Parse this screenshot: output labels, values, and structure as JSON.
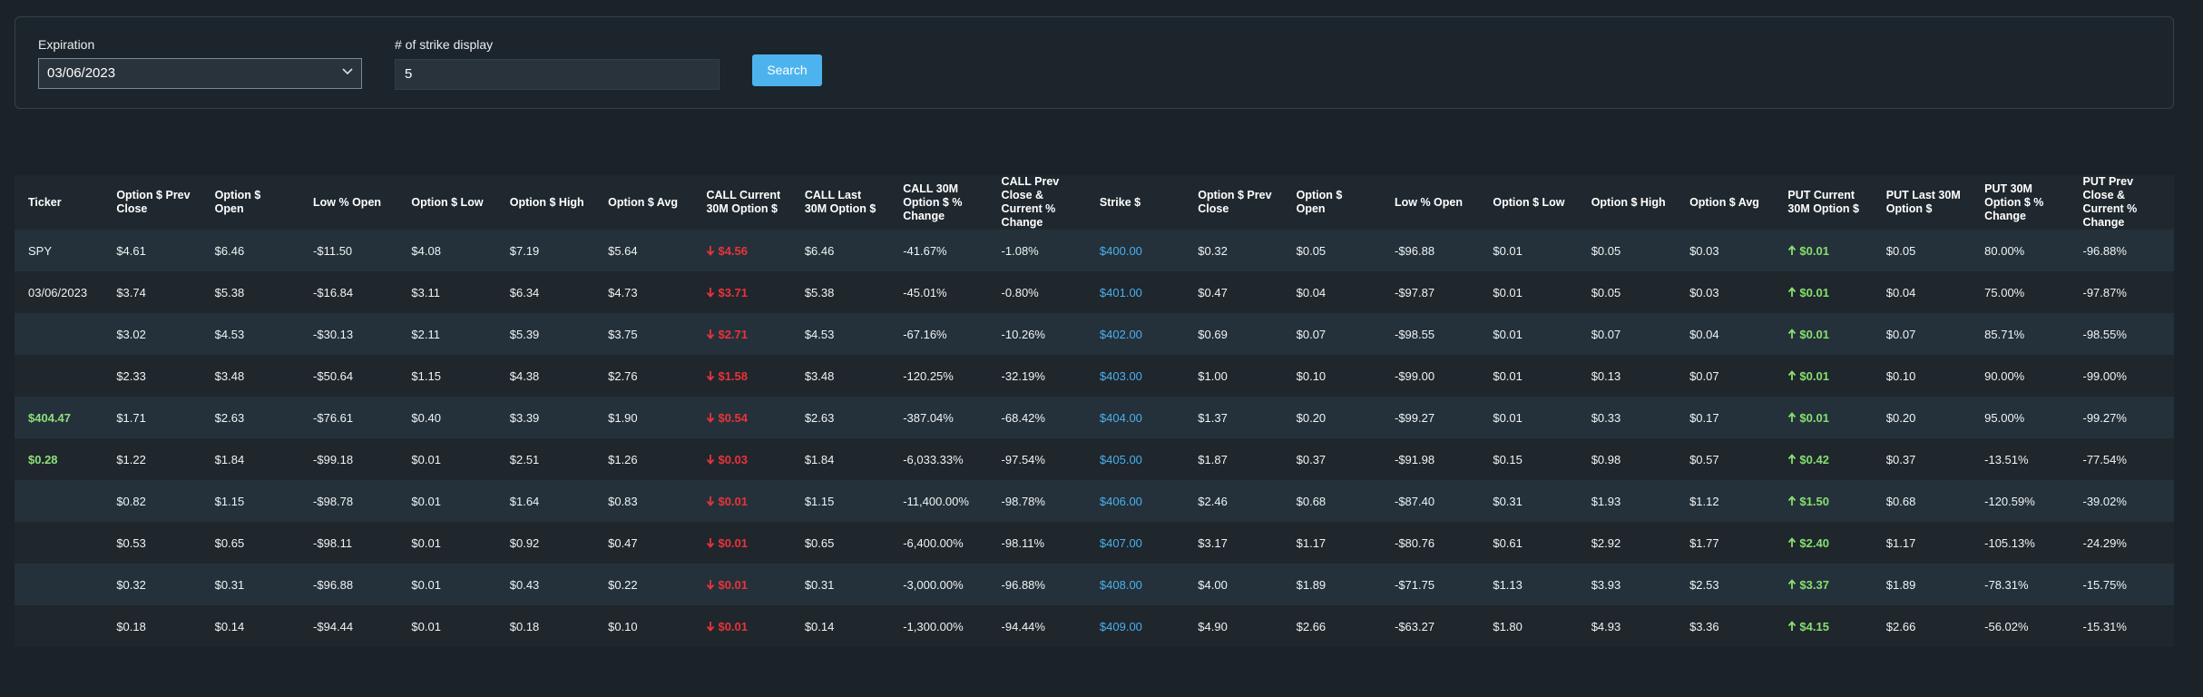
{
  "filters": {
    "expiration_label": "Expiration",
    "expiration_value": "03/06/2023",
    "strike_label": "# of strike display",
    "strike_value": "5",
    "search_label": "Search"
  },
  "table": {
    "headers": [
      "Ticker",
      "Option $ Prev Close",
      "Option $ Open",
      "Low % Open",
      "Option $ Low",
      "Option $ High",
      "Option $ Avg",
      "CALL Current 30M Option $",
      "CALL Last 30M Option $",
      "CALL 30M Option $ % Change",
      "CALL Prev Close & Current % Change",
      "Strike $",
      "Option $ Prev Close",
      "Option $ Open",
      "Low % Open",
      "Option $ Low",
      "Option $ High",
      "Option $ Avg",
      "PUT Current 30M Option $",
      "PUT Last 30M Option $",
      "PUT 30M Option $ % Change",
      "PUT Prev Close & Current % Change"
    ],
    "rows": [
      [
        "SPY",
        "$4.61",
        "$6.46",
        "-$11.50",
        "$4.08",
        "$7.19",
        "$5.64",
        "$4.56",
        "$6.46",
        "-41.67%",
        "-1.08%",
        "$400.00",
        "$0.32",
        "$0.05",
        "-$96.88",
        "$0.01",
        "$0.05",
        "$0.03",
        "$0.01",
        "$0.05",
        "80.00%",
        "-96.88%"
      ],
      [
        "03/06/2023",
        "$3.74",
        "$5.38",
        "-$16.84",
        "$3.11",
        "$6.34",
        "$4.73",
        "$3.71",
        "$5.38",
        "-45.01%",
        "-0.80%",
        "$401.00",
        "$0.47",
        "$0.04",
        "-$97.87",
        "$0.01",
        "$0.05",
        "$0.03",
        "$0.01",
        "$0.04",
        "75.00%",
        "-97.87%"
      ],
      [
        "",
        "$3.02",
        "$4.53",
        "-$30.13",
        "$2.11",
        "$5.39",
        "$3.75",
        "$2.71",
        "$4.53",
        "-67.16%",
        "-10.26%",
        "$402.00",
        "$0.69",
        "$0.07",
        "-$98.55",
        "$0.01",
        "$0.07",
        "$0.04",
        "$0.01",
        "$0.07",
        "85.71%",
        "-98.55%"
      ],
      [
        "",
        "$2.33",
        "$3.48",
        "-$50.64",
        "$1.15",
        "$4.38",
        "$2.76",
        "$1.58",
        "$3.48",
        "-120.25%",
        "-32.19%",
        "$403.00",
        "$1.00",
        "$0.10",
        "-$99.00",
        "$0.01",
        "$0.13",
        "$0.07",
        "$0.01",
        "$0.10",
        "90.00%",
        "-99.00%"
      ],
      [
        "$404.47",
        "$1.71",
        "$2.63",
        "-$76.61",
        "$0.40",
        "$3.39",
        "$1.90",
        "$0.54",
        "$2.63",
        "-387.04%",
        "-68.42%",
        "$404.00",
        "$1.37",
        "$0.20",
        "-$99.27",
        "$0.01",
        "$0.33",
        "$0.17",
        "$0.01",
        "$0.20",
        "95.00%",
        "-99.27%"
      ],
      [
        "$0.28",
        "$1.22",
        "$1.84",
        "-$99.18",
        "$0.01",
        "$2.51",
        "$1.26",
        "$0.03",
        "$1.84",
        "-6,033.33%",
        "-97.54%",
        "$405.00",
        "$1.87",
        "$0.37",
        "-$91.98",
        "$0.15",
        "$0.98",
        "$0.57",
        "$0.42",
        "$0.37",
        "-13.51%",
        "-77.54%"
      ],
      [
        "",
        "$0.82",
        "$1.15",
        "-$98.78",
        "$0.01",
        "$1.64",
        "$0.83",
        "$0.01",
        "$1.15",
        "-11,400.00%",
        "-98.78%",
        "$406.00",
        "$2.46",
        "$0.68",
        "-$87.40",
        "$0.31",
        "$1.93",
        "$1.12",
        "$1.50",
        "$0.68",
        "-120.59%",
        "-39.02%"
      ],
      [
        "",
        "$0.53",
        "$0.65",
        "-$98.11",
        "$0.01",
        "$0.92",
        "$0.47",
        "$0.01",
        "$0.65",
        "-6,400.00%",
        "-98.11%",
        "$407.00",
        "$3.17",
        "$1.17",
        "-$80.76",
        "$0.61",
        "$2.92",
        "$1.77",
        "$2.40",
        "$1.17",
        "-105.13%",
        "-24.29%"
      ],
      [
        "",
        "$0.32",
        "$0.31",
        "-$96.88",
        "$0.01",
        "$0.43",
        "$0.22",
        "$0.01",
        "$0.31",
        "-3,000.00%",
        "-96.88%",
        "$408.00",
        "$4.00",
        "$1.89",
        "-$71.75",
        "$1.13",
        "$3.93",
        "$2.53",
        "$3.37",
        "$1.89",
        "-78.31%",
        "-15.75%"
      ],
      [
        "",
        "$0.18",
        "$0.14",
        "-$94.44",
        "$0.01",
        "$0.18",
        "$0.10",
        "$0.01",
        "$0.14",
        "-1,300.00%",
        "-94.44%",
        "$409.00",
        "$4.90",
        "$2.66",
        "-$63.27",
        "$1.80",
        "$4.93",
        "$3.36",
        "$4.15",
        "$2.66",
        "-56.02%",
        "-15.31%"
      ]
    ]
  },
  "colors": {
    "call_down": "#e8333a",
    "put_up": "#86df6f",
    "strike": "#4ab0ee",
    "ticker_price": "#8ee07a"
  },
  "icons": {
    "expiration_dropdown": "chevron-down-icon",
    "call_change": "arrow-down-icon",
    "put_change": "arrow-up-icon"
  }
}
